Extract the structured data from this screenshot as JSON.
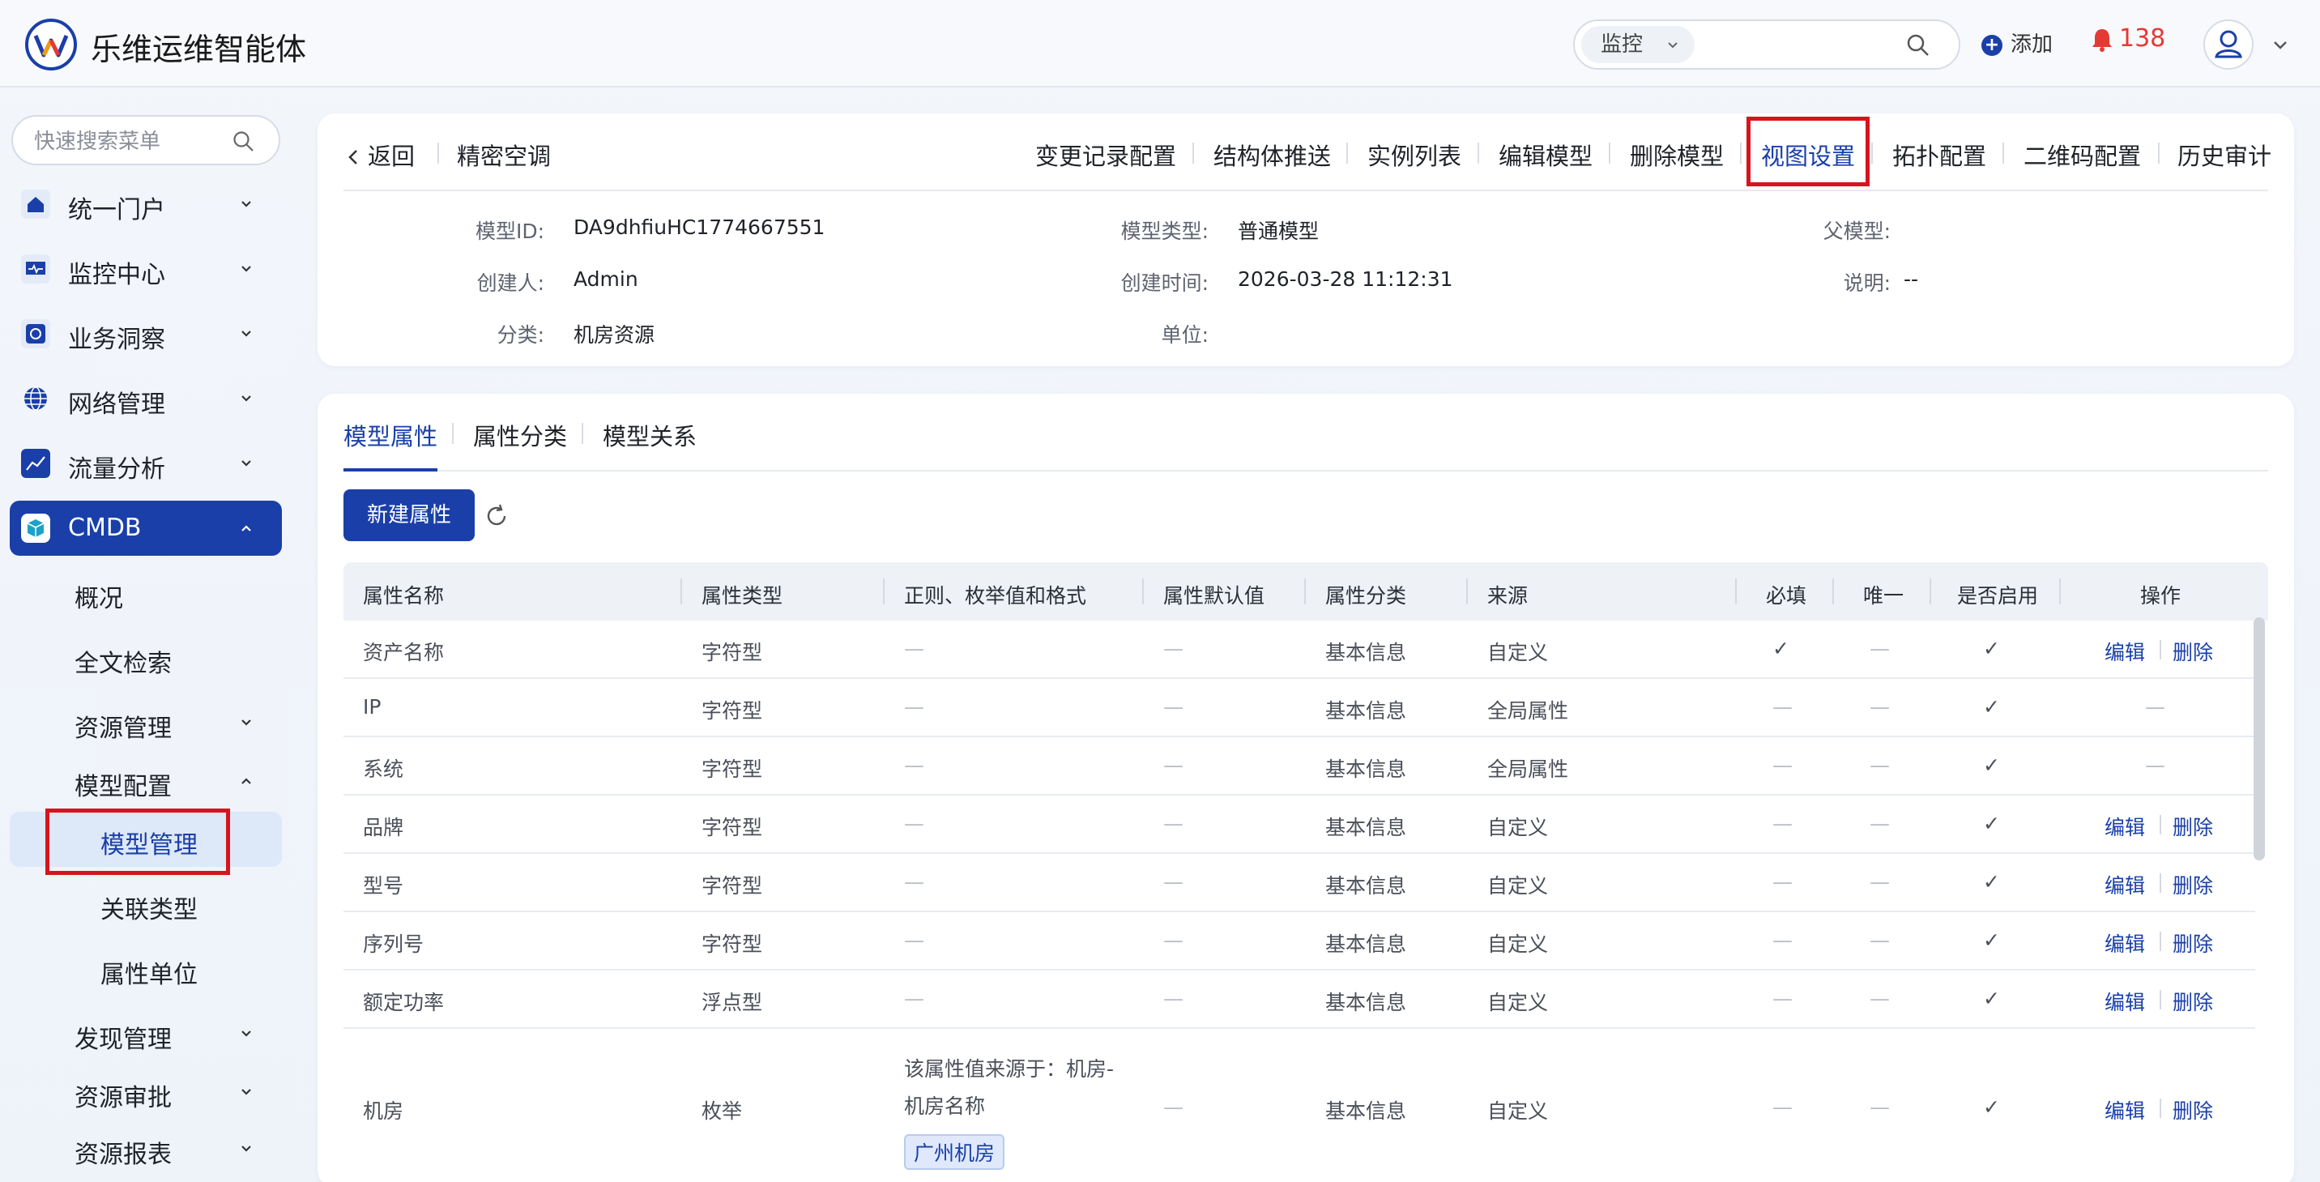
{
  "app": {
    "title": "乐维运维智能体"
  },
  "topbar": {
    "search_scope": "监控",
    "add_label": "添加",
    "alert_count": "138"
  },
  "sidebar": {
    "search_placeholder": "快速搜索菜单",
    "items": [
      {
        "label": "统一门户"
      },
      {
        "label": "监控中心"
      },
      {
        "label": "业务洞察"
      },
      {
        "label": "网络管理"
      },
      {
        "label": "流量分析"
      },
      {
        "label": "CMDB"
      }
    ],
    "cmdb_sub": [
      {
        "label": "概况"
      },
      {
        "label": "全文检索"
      },
      {
        "label": "资源管理"
      },
      {
        "label": "模型配置"
      }
    ],
    "model_sub": [
      {
        "label": "模型管理"
      },
      {
        "label": "关联类型"
      },
      {
        "label": "属性单位"
      }
    ],
    "bottom_items": [
      {
        "label": "发现管理"
      },
      {
        "label": "资源审批"
      },
      {
        "label": "资源报表"
      }
    ]
  },
  "header": {
    "back_label": "返回",
    "model_name": "精密空调",
    "actions": [
      "变更记录配置",
      "结构体推送",
      "实例列表",
      "编辑模型",
      "删除模型",
      "视图设置",
      "拓扑配置",
      "二维码配置",
      "历史审计"
    ],
    "info": {
      "model_id_label": "模型ID:",
      "model_id": "DA9dhfiuHC1774667551",
      "model_type_label": "模型类型:",
      "model_type": "普通模型",
      "parent_label": "父模型:",
      "parent": "",
      "creator_label": "创建人:",
      "creator": "Admin",
      "created_label": "创建时间:",
      "created": "2026-03-28 11:12:31",
      "desc_label": "说明:",
      "desc": "--",
      "category_label": "分类:",
      "category": "机房资源",
      "unit_label": "单位:",
      "unit": ""
    }
  },
  "main": {
    "tabs": [
      "模型属性",
      "属性分类",
      "模型关系"
    ],
    "new_button": "新建属性",
    "columns": [
      "属性名称",
      "属性类型",
      "正则、枚举值和格式",
      "属性默认值",
      "属性分类",
      "来源",
      "必填",
      "唯一",
      "是否启用",
      "操作"
    ],
    "rows": [
      {
        "name": "资产名称",
        "type": "字符型",
        "regex": "—",
        "default": "—",
        "category": "基本信息",
        "source": "自定义",
        "required": "✓",
        "unique": "—",
        "enabled": "✓",
        "edit": "编辑",
        "delete": "删除"
      },
      {
        "name": "IP",
        "type": "字符型",
        "regex": "—",
        "default": "—",
        "category": "基本信息",
        "source": "全局属性",
        "required": "—",
        "unique": "—",
        "enabled": "✓",
        "op": "—"
      },
      {
        "name": "系统",
        "type": "字符型",
        "regex": "—",
        "default": "—",
        "category": "基本信息",
        "source": "全局属性",
        "required": "—",
        "unique": "—",
        "enabled": "✓",
        "op": "—"
      },
      {
        "name": "品牌",
        "type": "字符型",
        "regex": "—",
        "default": "—",
        "category": "基本信息",
        "source": "自定义",
        "required": "—",
        "unique": "—",
        "enabled": "✓",
        "edit": "编辑",
        "delete": "删除"
      },
      {
        "name": "型号",
        "type": "字符型",
        "regex": "—",
        "default": "—",
        "category": "基本信息",
        "source": "自定义",
        "required": "—",
        "unique": "—",
        "enabled": "✓",
        "edit": "编辑",
        "delete": "删除"
      },
      {
        "name": "序列号",
        "type": "字符型",
        "regex": "—",
        "default": "—",
        "category": "基本信息",
        "source": "自定义",
        "required": "—",
        "unique": "—",
        "enabled": "✓",
        "edit": "编辑",
        "delete": "删除"
      },
      {
        "name": "额定功率",
        "type": "浮点型",
        "regex": "—",
        "default": "—",
        "category": "基本信息",
        "source": "自定义",
        "required": "—",
        "unique": "—",
        "enabled": "✓",
        "edit": "编辑",
        "delete": "删除"
      },
      {
        "name": "机房",
        "type": "枚举",
        "regex_line1": "该属性值来源于：机房-",
        "regex_line2": "机房名称",
        "regex_tag": "广州机房",
        "default": "—",
        "category": "基本信息",
        "source": "自定义",
        "required": "—",
        "unique": "—",
        "enabled": "✓",
        "edit": "编辑",
        "delete": "删除"
      }
    ]
  },
  "colors": {
    "primary": "#1a3fa8",
    "alert": "#e53935",
    "highlight_box": "#d7141d"
  }
}
